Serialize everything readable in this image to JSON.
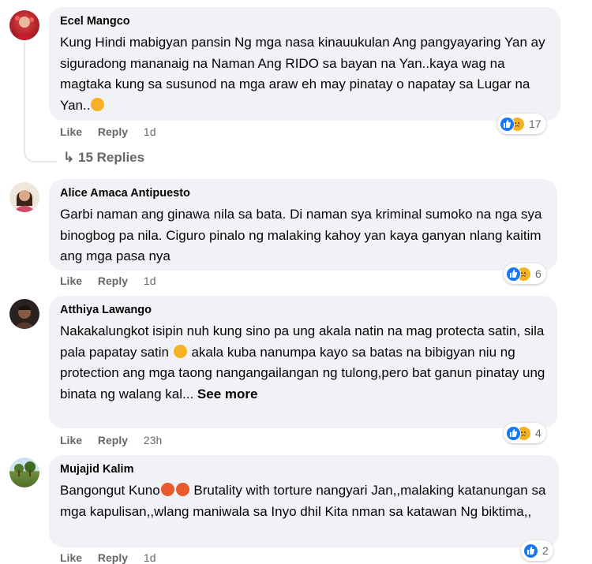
{
  "comments": [
    {
      "author": "Ecel Mangco",
      "text": "Kung Hindi mabigyan pansin Ng mga nasa kinauukulan Ang pangyayaring Yan ay siguradong mananaig na Naman Ang RIDO sa bayan na Yan..kaya wag na magtaka kung sa susunod na mga araw eh may pinatay o napatay sa Lugar na Yan..",
      "emoji": "sad-face-emoji",
      "like_label": "Like",
      "reply_label": "Reply",
      "time": "1d",
      "reaction_count": "17",
      "replies_label": "15 Replies"
    },
    {
      "author": "Alice Amaca Antipuesto",
      "text": "Garbi naman ang ginawa nila sa bata. Di naman sya kriminal sumoko na nga sya binogbog pa nila. Ciguro pinalo ng malaking kahoy yan kaya ganyan nlang kaitim ang mga pasa nya",
      "like_label": "Like",
      "reply_label": "Reply",
      "time": "1d",
      "reaction_count": "6"
    },
    {
      "author": "Atthiya Lawango",
      "text_before_emoji": "Nakakalungkot isipin nuh kung sino pa ung akala natin na mag protecta satin, sila pala papatay satin",
      "text_after_emoji": "akala kuba nanumpa kayo sa batas na bibigyan niu ng protection ang mga taong nangangailangan ng tulong,pero bat ganun pinatay ung binata ng walang kal...",
      "see_more": "See more",
      "emoji": "sleepy-face-emoji",
      "like_label": "Like",
      "reply_label": "Reply",
      "time": "23h",
      "reaction_count": "4"
    },
    {
      "author": "Mujajid Kalim",
      "text_before_emoji": "Bangongut Kuno",
      "text_after_emoji": "Brutality with torture nangyari Jan,,malaking katanungan sa mga kapulisan,,wlang maniwala sa Inyo dhil Kita nman sa katawan Ng biktima,,",
      "emoji": "angry-face-emoji",
      "like_label": "Like",
      "reply_label": "Reply",
      "time": "1d",
      "reaction_count": "2"
    }
  ],
  "colors": {
    "bubble": "#f0f2f5",
    "secondary_text": "#65676b",
    "like_blue": "#1877f2",
    "sad_yellow": "#f7b125",
    "angry_red": "#e8592b"
  }
}
